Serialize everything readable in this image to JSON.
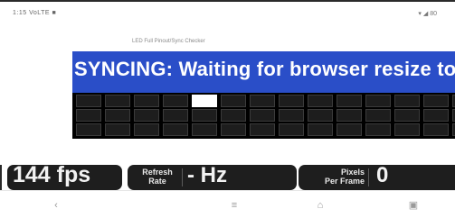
{
  "status_bar": {
    "left_text": "1:15 VoLTE ■",
    "right_text": "▾ ◢ 80"
  },
  "page": {
    "heading": "LED Full Pinout/Sync Checker"
  },
  "sync_banner": {
    "text": "SYNCING: Waiting for browser resize to"
  },
  "grid": {
    "rows": 3,
    "columns": 14,
    "highlighted": [
      {
        "row": 0,
        "col": 4
      }
    ]
  },
  "hud": {
    "fps": "144 fps",
    "refresh_label": "Refresh Rate",
    "refresh_value": "- Hz",
    "ppf_label": "Pixels Per Frame",
    "ppf_value": "0"
  },
  "nav": {
    "back_icon": "back-icon",
    "menu_icon": "menu-icon",
    "home_icon": "home-icon",
    "recents_icon": "recents-icon"
  },
  "colors": {
    "banner": "#2a4ec8",
    "hud_panel": "#1e1e1e",
    "highlight_cell": "#ffffff"
  }
}
